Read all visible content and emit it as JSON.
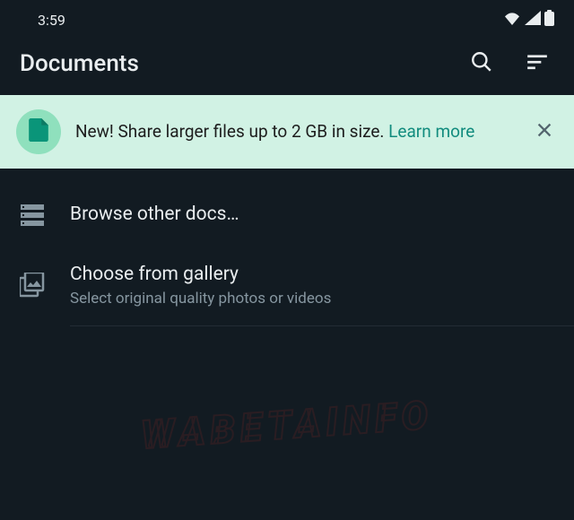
{
  "status": {
    "time": "3:59"
  },
  "header": {
    "title": "Documents"
  },
  "banner": {
    "text_prefix": "New! Share larger files up to 2 GB in size. ",
    "link": "Learn more"
  },
  "list": {
    "browse": {
      "title": "Browse other docs…"
    },
    "gallery": {
      "title": "Choose from gallery",
      "subtitle": "Select original quality photos or videos"
    }
  },
  "watermark": "WABETAINFO"
}
